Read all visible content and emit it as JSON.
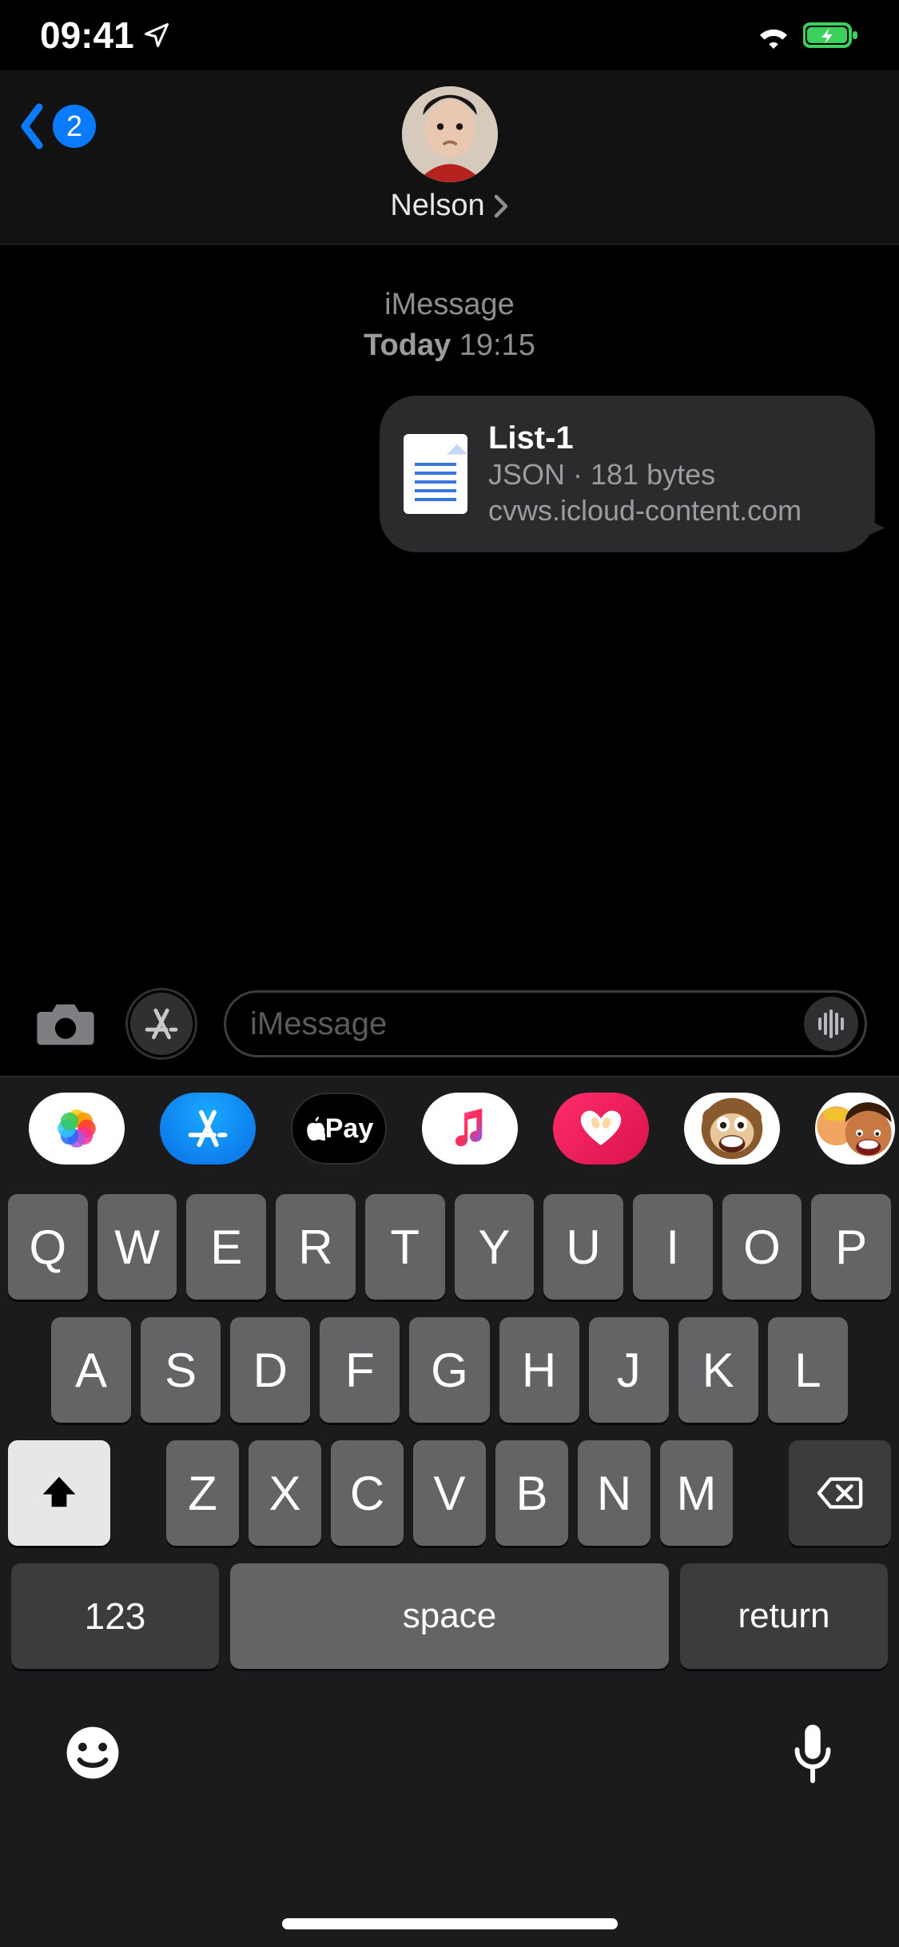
{
  "status": {
    "time": "09:41"
  },
  "nav": {
    "back_count": "2",
    "contact_name": "Nelson"
  },
  "thread": {
    "service": "iMessage",
    "day": "Today",
    "time": "19:15",
    "attachment": {
      "title": "List-1",
      "meta": "JSON · 181 bytes",
      "source": "cvws.icloud-content.com"
    }
  },
  "compose": {
    "placeholder": "iMessage"
  },
  "apps": {
    "pay_label": "Pay"
  },
  "keyboard": {
    "row1": [
      "Q",
      "W",
      "E",
      "R",
      "T",
      "Y",
      "U",
      "I",
      "O",
      "P"
    ],
    "row2": [
      "A",
      "S",
      "D",
      "F",
      "G",
      "H",
      "J",
      "K",
      "L"
    ],
    "row3": [
      "Z",
      "X",
      "C",
      "V",
      "B",
      "N",
      "M"
    ],
    "k123": "123",
    "space": "space",
    "return": "return"
  }
}
